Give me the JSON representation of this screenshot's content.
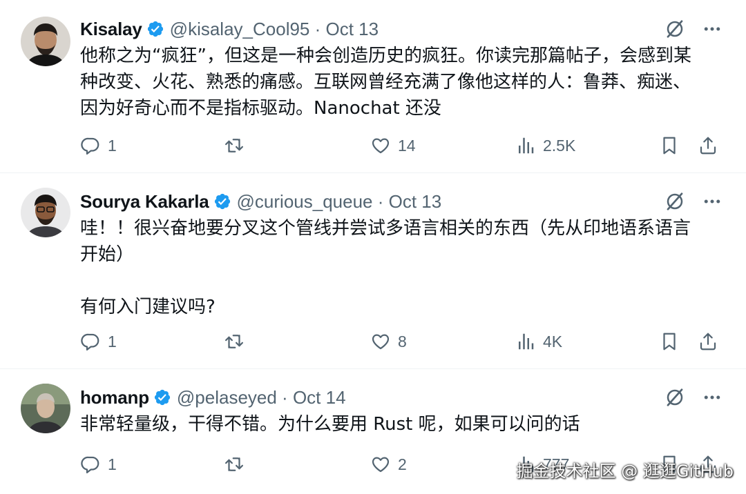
{
  "tweets": [
    {
      "name": "Kisalay",
      "handle": "@kisalay_Cool95 · Oct 13",
      "lines": [
        "他称之为“疯狂”，但这是一种会创造历史的疯狂。你读完那篇帖子，会感到某",
        "种改变、火花、熟悉的痛感。互联网曾经充满了像他这样的人：鲁莽、痴迷、",
        "因为好奇心而不是指标驱动。Nanochat 还没"
      ],
      "replies": "1",
      "retweets": "",
      "likes": "14",
      "views": "2.5K"
    },
    {
      "name": "Sourya Kakarla",
      "handle": "@curious_queue · Oct 13",
      "lines": [
        "哇！！很兴奋地要分叉这个管线并尝试多语言相关的东西（先从印地语系语言",
        "开始）",
        "有何入门建议吗?"
      ],
      "replies": "1",
      "retweets": "",
      "likes": "8",
      "views": "4K"
    },
    {
      "name": "homanp",
      "handle": "@pelaseyed · Oct 14",
      "lines": [
        "非常轻量级，干得不错。为什么要用 Rust 呢，如果可以问的话"
      ],
      "replies": "1",
      "retweets": "",
      "likes": "2",
      "views": "777"
    }
  ],
  "icons": {
    "verified": "verified-badge-icon",
    "grok": "grok-icon",
    "more": "more-icon",
    "reply": "reply-icon",
    "retweet": "retweet-icon",
    "like": "like-icon",
    "views": "views-icon",
    "bookmark": "bookmark-icon",
    "share": "share-icon"
  },
  "colors": {
    "verified": "#1d9bf0",
    "secondary": "#536471",
    "text": "#0f1419"
  },
  "watermark": "掘金技术社区 @ 逛逛GitHub"
}
